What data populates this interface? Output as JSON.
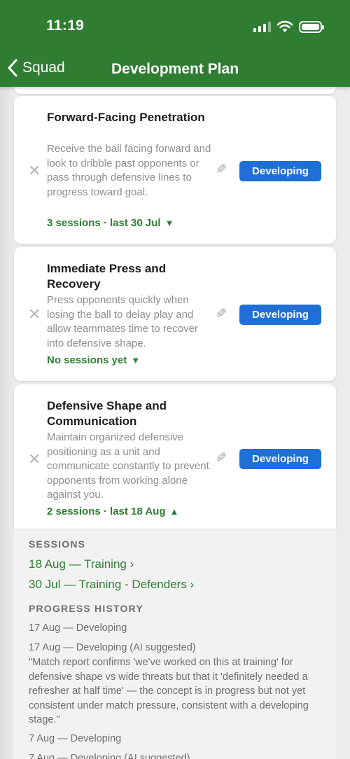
{
  "status_bar": {
    "time": "11:19"
  },
  "nav": {
    "back_label": "Squad",
    "title": "Development Plan"
  },
  "cards": [
    {
      "title": "Forward-Facing Penetration",
      "description": "Receive the ball facing forward and look to dribble past opponents or pass through defensive lines to progress toward goal.",
      "sessions": "3 sessions · last 30 Jul",
      "toggle": "▼",
      "status": "Developing"
    },
    {
      "title": "Immediate Press and Recovery",
      "description": "Press opponents quickly when losing the ball to delay play and allow teammates time to recover into defensive shape.",
      "sessions": "No sessions yet",
      "toggle": "▼",
      "status": "Developing"
    },
    {
      "title": "Defensive Shape and Communication",
      "description": "Maintain organized defensive positioning as a unit and communicate constantly to prevent opponents from working alone against you.",
      "sessions": "2 sessions · last 18 Aug",
      "toggle": "▲",
      "status": "Developing"
    }
  ],
  "expanded": {
    "sessions_label": "SESSIONS",
    "sessions": [
      "18 Aug — Training ›",
      "30 Jul — Training - Defenders ›"
    ],
    "history_label": "PROGRESS HISTORY",
    "history": [
      "17 Aug — Developing",
      "17 Aug — Developing (AI suggested)",
      "\"Match report confirms 'we've worked on this at training' for defensive shape vs wide threats but that it 'definitely needed a refresher at half time' — the concept is in progress but not yet consistent under match pressure, consistent with a developing stage.\"",
      "7 Aug — Developing",
      "7 Aug — Developing (AI suggested)"
    ]
  },
  "colors": {
    "header": "#2f7d32",
    "accent_green": "#2f7d32",
    "pill_blue": "#1f6fd6"
  },
  "icons": {
    "back": "chevron-left-icon",
    "remove": "close-icon",
    "edit": "pencil-icon",
    "signal": "signal-icon",
    "wifi": "wifi-icon",
    "battery": "battery-icon"
  }
}
